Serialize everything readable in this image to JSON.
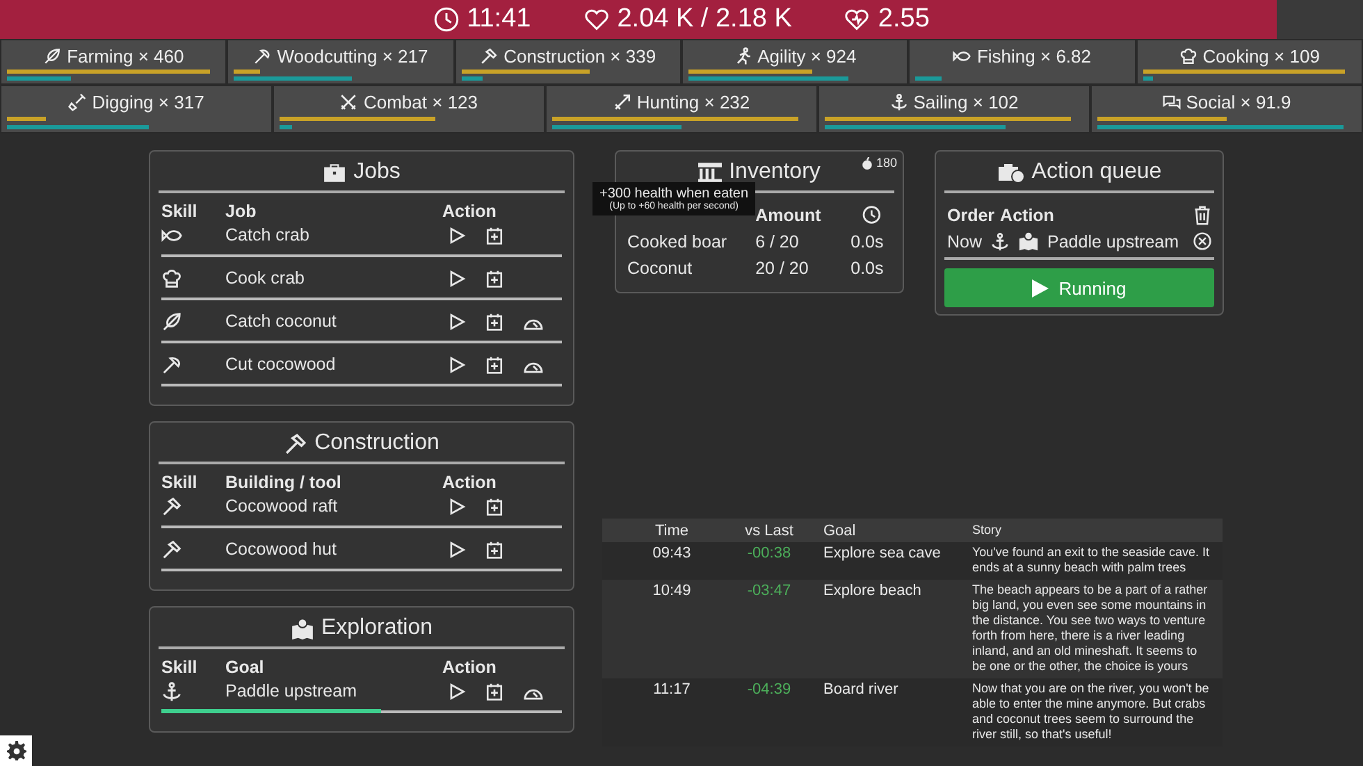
{
  "top_bar": {
    "time": "11:41",
    "health": "2.04 K / 2.18 K",
    "regen": "2.55"
  },
  "skills": [
    {
      "kind": "farming",
      "label": "Farming × 460",
      "bars": [
        {
          "kind": "xp",
          "level": 0.95
        },
        {
          "kind": "speed",
          "level": 0.3
        }
      ]
    },
    {
      "kind": "woodcutting",
      "label": "Woodcutting × 217",
      "bars": [
        {
          "kind": "xp",
          "level": 0.12
        },
        {
          "kind": "speed",
          "level": 0.55
        }
      ]
    },
    {
      "kind": "construction",
      "label": "Construction × 339",
      "bars": [
        {
          "kind": "xp",
          "level": 0.6
        },
        {
          "kind": "speed",
          "level": 0.1
        }
      ]
    },
    {
      "kind": "agility",
      "label": "Agility × 924",
      "bars": [
        {
          "kind": "xp",
          "level": 0.58
        },
        {
          "kind": "speed",
          "level": 0.75
        }
      ]
    },
    {
      "kind": "fishing",
      "label": "Fishing × 6.82",
      "bars": [
        {
          "kind": "speed",
          "level": 0.12
        }
      ]
    },
    {
      "kind": "cooking",
      "label": "Cooking × 109",
      "bars": [
        {
          "kind": "xp",
          "level": 0.95
        },
        {
          "kind": "speed",
          "level": 0.05
        }
      ]
    },
    {
      "kind": "digging",
      "label": "Digging × 317",
      "bars": [
        {
          "kind": "xp",
          "level": 0.15
        },
        {
          "kind": "speed",
          "level": 0.55
        }
      ]
    },
    {
      "kind": "combat",
      "label": "Combat × 123",
      "bars": [
        {
          "kind": "xp",
          "level": 0.6
        },
        {
          "kind": "speed",
          "level": 0.05
        }
      ]
    },
    {
      "kind": "hunting",
      "label": "Hunting × 232",
      "bars": [
        {
          "kind": "xp",
          "level": 0.95
        },
        {
          "kind": "speed",
          "level": 0.5
        }
      ]
    },
    {
      "kind": "sailing",
      "label": "Sailing × 102",
      "bars": [
        {
          "kind": "xp",
          "level": 0.95
        },
        {
          "kind": "speed",
          "level": 0.7
        }
      ]
    },
    {
      "kind": "social",
      "label": "Social × 91.9",
      "bars": [
        {
          "kind": "xp",
          "level": 0.5
        },
        {
          "kind": "speed",
          "level": 0.95
        }
      ]
    }
  ],
  "panels": [
    {
      "kind": "briefcase",
      "title": "Jobs",
      "columns": [
        "Skill",
        "Job",
        "Action"
      ],
      "rows": [
        {
          "kind": "fishing",
          "name": "Catch crab",
          "actions": [
            {
              "kind": "play"
            },
            {
              "kind": "queue"
            }
          ]
        },
        {
          "kind": "cooking",
          "name": "Cook crab",
          "actions": [
            {
              "kind": "play"
            },
            {
              "kind": "queue"
            }
          ]
        },
        {
          "kind": "farming",
          "name": "Catch coconut",
          "actions": [
            {
              "kind": "play"
            },
            {
              "kind": "queue"
            },
            {
              "kind": "gauge"
            }
          ]
        },
        {
          "kind": "woodcutting",
          "name": "Cut cocowood",
          "actions": [
            {
              "kind": "play"
            },
            {
              "kind": "queue"
            },
            {
              "kind": "gauge"
            }
          ]
        }
      ]
    },
    {
      "kind": "construction",
      "title": "Construction",
      "columns": [
        "Skill",
        "Building / tool",
        "Action"
      ],
      "rows": [
        {
          "kind": "construction",
          "name": "Cocowood raft",
          "actions": [
            {
              "kind": "play"
            },
            {
              "kind": "queue"
            }
          ]
        },
        {
          "kind": "construction",
          "name": "Cocowood hut",
          "actions": [
            {
              "kind": "play"
            },
            {
              "kind": "queue"
            }
          ]
        }
      ]
    },
    {
      "kind": "map",
      "title": "Exploration",
      "columns": [
        "Skill",
        "Goal",
        "Action"
      ],
      "rows": [
        {
          "kind": "sailing",
          "name": "Paddle upstream",
          "level": 0.55,
          "actions": [
            {
              "kind": "play"
            },
            {
              "kind": "queue"
            },
            {
              "kind": "gauge"
            }
          ]
        }
      ]
    }
  ],
  "inventory": {
    "title": "Inventory",
    "badge": "180",
    "columns": [
      "Amount"
    ],
    "rows": [
      {
        "item": "Cooked boar",
        "amount": "6 / 20",
        "time": "0.0s"
      },
      {
        "item": "Coconut",
        "amount": "20 / 20",
        "time": "0.0s"
      }
    ],
    "tooltip": {
      "title": "+300 health when eaten",
      "detail": "(Up to +60 health per second)"
    }
  },
  "action_queue": {
    "title": "Action queue",
    "columns": [
      "Order",
      "Action"
    ],
    "rows": [
      {
        "order": "Now",
        "action": "Paddle upstream"
      }
    ],
    "button": "Running"
  },
  "log": {
    "columns": [
      "Time",
      "vs Last",
      "Goal",
      "Story"
    ],
    "rows": [
      {
        "time": "09:43",
        "delta": "-00:38",
        "goal": "Explore sea cave",
        "story": "You've found an exit to the seaside cave. It ends at a sunny beach with palm trees"
      },
      {
        "time": "10:49",
        "delta": "-03:47",
        "goal": "Explore beach",
        "story": "The beach appears to be a part of a rather big land, you even see some mountains in the distance. You see two ways to venture forth from here, there is a river leading inland, and an old mineshaft. It seems to be one or the other, the choice is yours"
      },
      {
        "time": "11:17",
        "delta": "-04:39",
        "goal": "Board river",
        "story": "Now that you are on the river, you won't be able to enter the mine anymore. But crabs and coconut trees seem to surround the river still, so that's useful!"
      }
    ]
  }
}
